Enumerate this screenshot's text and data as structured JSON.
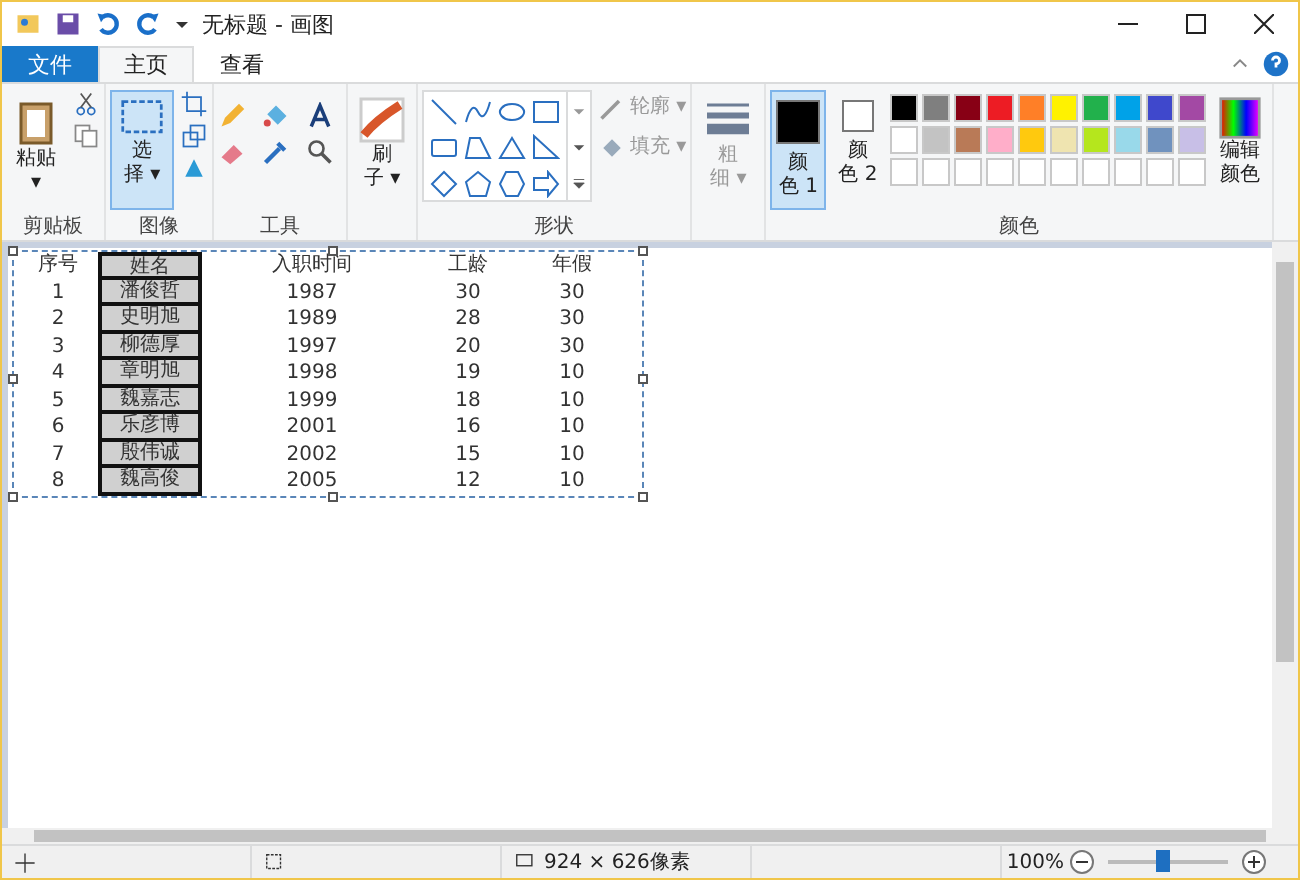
{
  "window": {
    "title": "无标题 - 画图"
  },
  "tabs": [
    {
      "label": "文件",
      "kind": "file",
      "selected": false
    },
    {
      "label": "主页",
      "kind": "tab",
      "selected": true
    },
    {
      "label": "查看",
      "kind": "tab",
      "selected": false
    }
  ],
  "ribbon": {
    "clipboard": {
      "paste_lines": [
        "粘贴",
        "▾"
      ],
      "label": "剪贴板"
    },
    "image": {
      "select_lines": [
        "选",
        "择 ▾"
      ],
      "select_selected": true,
      "label": "图像"
    },
    "tools": {
      "label": "工具"
    },
    "brush": {
      "lines": [
        "刷",
        "子 ▾"
      ]
    },
    "shapes": {
      "outline": "轮廓 ▾",
      "fill": "填充 ▾",
      "label": "形状"
    },
    "size": {
      "lines": [
        "粗",
        "细 ▾"
      ]
    },
    "colors": {
      "slots": [
        {
          "lines": [
            "颜",
            "色 1"
          ],
          "color": "#000000",
          "selected": true
        },
        {
          "lines": [
            "颜",
            "色 2"
          ],
          "color": "#ffffff",
          "selected": false
        }
      ],
      "palette": [
        [
          {
            "color": "#000000"
          },
          {
            "color": "#7f7f7f"
          },
          {
            "color": "#880015"
          },
          {
            "color": "#ed1c24"
          },
          {
            "color": "#ff7f27"
          },
          {
            "color": "#fff200"
          },
          {
            "color": "#22b14c"
          },
          {
            "color": "#00a2e8"
          },
          {
            "color": "#3f48cc"
          },
          {
            "color": "#a349a4"
          }
        ],
        [
          {
            "color": "#ffffff"
          },
          {
            "color": "#c3c3c3"
          },
          {
            "color": "#b97a57"
          },
          {
            "color": "#ffaec9"
          },
          {
            "color": "#ffc90e"
          },
          {
            "color": "#efe4b0"
          },
          {
            "color": "#b5e61d"
          },
          {
            "color": "#99d9ea"
          },
          {
            "color": "#7092be"
          },
          {
            "color": "#c8bfe7"
          }
        ]
      ],
      "edit_lines": [
        "编辑",
        "颜色"
      ],
      "label": "颜色"
    }
  },
  "canvas_table": {
    "columns": [
      "序号",
      "姓名",
      "入职时间",
      "工龄",
      "年假"
    ],
    "rows": [
      [
        "1",
        "潘俊哲",
        "1987",
        "30",
        "30"
      ],
      [
        "2",
        "史明旭",
        "1989",
        "28",
        "30"
      ],
      [
        "3",
        "柳德厚",
        "1997",
        "20",
        "30"
      ],
      [
        "4",
        "章明旭",
        "1998",
        "19",
        "10"
      ],
      [
        "5",
        "魏嘉志",
        "1999",
        "18",
        "10"
      ],
      [
        "6",
        "乐彦博",
        "2001",
        "16",
        "10"
      ],
      [
        "7",
        "殷伟诚",
        "2002",
        "15",
        "10"
      ],
      [
        "8",
        "魏高俊",
        "2005",
        "12",
        "10"
      ]
    ]
  },
  "status_bar": {
    "size": "924 × 626像素",
    "zoom": "100%",
    "zoom_level": {
      "level": 0.45
    }
  }
}
